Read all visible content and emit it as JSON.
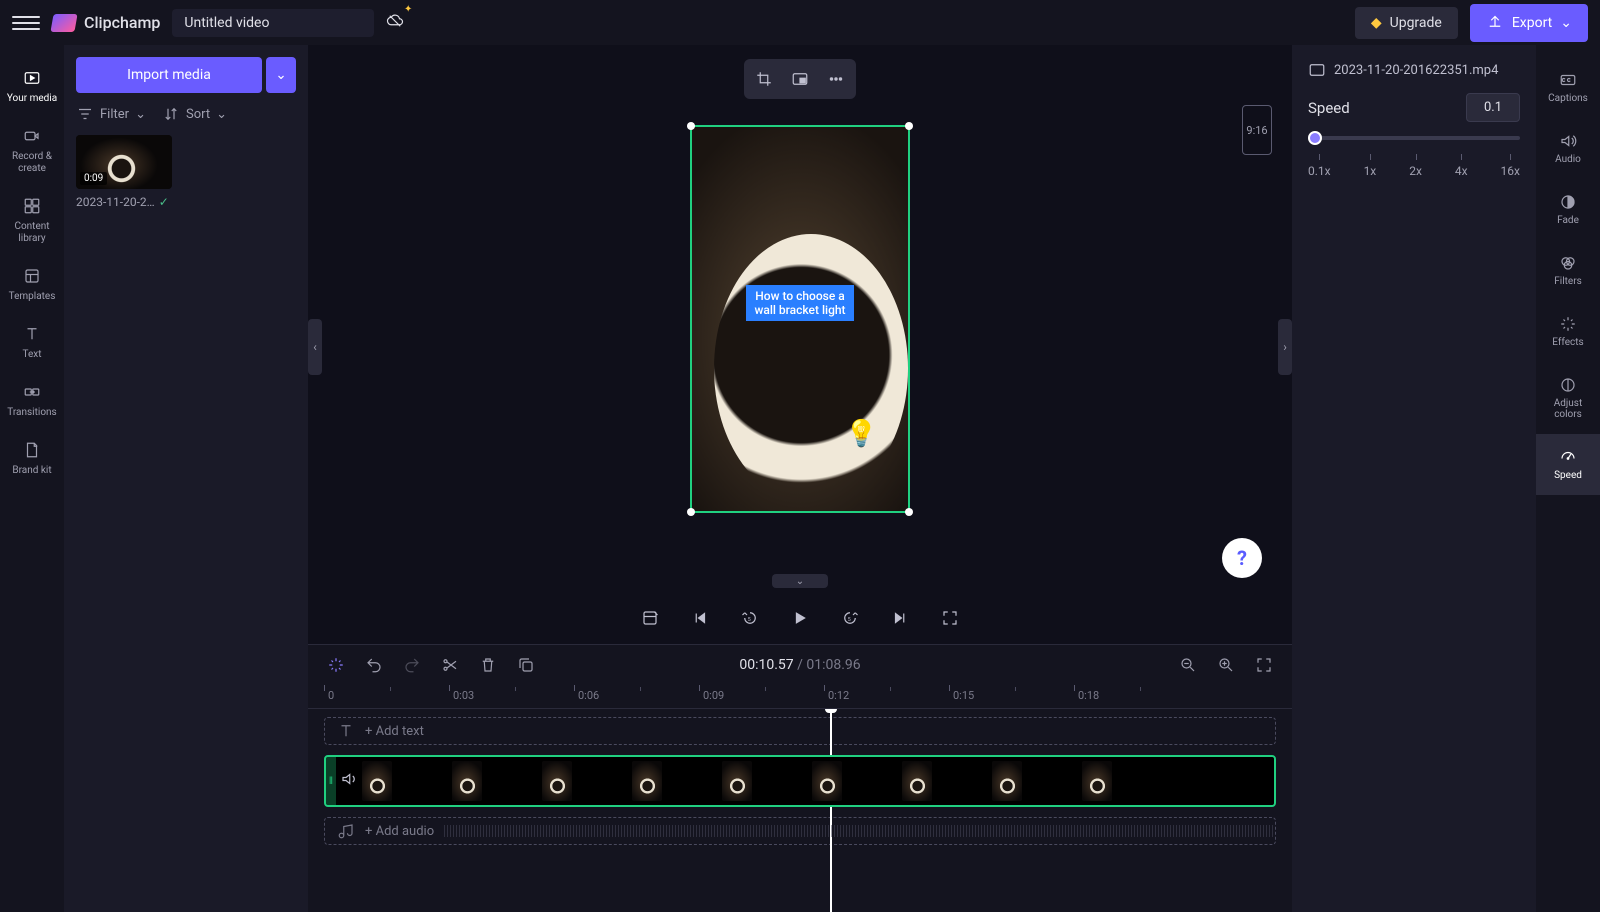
{
  "app": {
    "name": "Clipchamp",
    "project_title": "Untitled video"
  },
  "topbar": {
    "upgrade": "Upgrade",
    "export": "Export"
  },
  "leftnav": [
    {
      "id": "your-media",
      "label": "Your media"
    },
    {
      "id": "record-create",
      "label": "Record & create"
    },
    {
      "id": "content-library",
      "label": "Content library"
    },
    {
      "id": "templates",
      "label": "Templates"
    },
    {
      "id": "text",
      "label": "Text"
    },
    {
      "id": "transitions",
      "label": "Transitions"
    },
    {
      "id": "brand-kit",
      "label": "Brand kit"
    }
  ],
  "media": {
    "import": "Import media",
    "filter": "Filter",
    "sort": "Sort",
    "clips": [
      {
        "duration": "0:09",
        "name": "2023-11-20-2…"
      }
    ]
  },
  "preview": {
    "aspect": "9:16",
    "caption": "How to choose a wall bracket light"
  },
  "playback": {
    "current": "00:10.57",
    "separator": "/",
    "total": "01:08.96"
  },
  "ruler": [
    "0",
    "0:03",
    "0:06",
    "0:09",
    "0:12",
    "0:15",
    "0:18"
  ],
  "tracks": {
    "add_text": "+ Add text",
    "add_audio": "+ Add audio"
  },
  "properties": {
    "clip_name": "2023-11-20-201622351.mp4",
    "speed_label": "Speed",
    "speed_value": "0.1",
    "speed_ticks": [
      "0.1x",
      "1x",
      "2x",
      "4x",
      "16x"
    ]
  },
  "rightnav": [
    {
      "id": "captions",
      "label": "Captions"
    },
    {
      "id": "audio",
      "label": "Audio"
    },
    {
      "id": "fade",
      "label": "Fade"
    },
    {
      "id": "filters",
      "label": "Filters"
    },
    {
      "id": "effects",
      "label": "Effects"
    },
    {
      "id": "adjust-colors",
      "label": "Adjust colors"
    },
    {
      "id": "speed",
      "label": "Speed"
    }
  ]
}
